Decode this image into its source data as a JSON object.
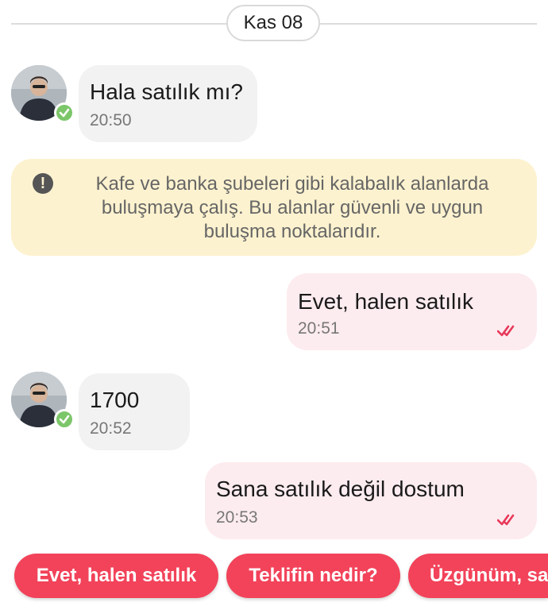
{
  "date_separator": "Kas 08",
  "messages": [
    {
      "direction": "incoming",
      "text": "Hala satılık mı?",
      "time": "20:50"
    },
    {
      "direction": "outgoing",
      "text": "Evet, halen satılık",
      "time": "20:51",
      "read": true
    },
    {
      "direction": "incoming",
      "text": "1700",
      "time": "20:52"
    },
    {
      "direction": "outgoing",
      "text": "Sana satılık değil dostum",
      "time": "20:53",
      "read": true
    }
  ],
  "safety_notice": {
    "icon": "exclamation-circle-icon",
    "line1": "Kafe ve banka şubeleri gibi kalabalık alanlarda",
    "line2": "buluşmaya çalış. Bu alanlar güvenli ve uygun",
    "line3": "buluşma noktalarıdır."
  },
  "quick_replies": [
    "Evet, halen satılık",
    "Teklifin nedir?",
    "Üzgünüm, sa"
  ],
  "colors": {
    "accent": "#f2435a",
    "outgoing_bubble": "#fdecef",
    "incoming_bubble": "#f2f2f2",
    "notice_bg": "#fdf2cf",
    "verified": "#7cc66a",
    "read_ticks": "#e8385a"
  }
}
